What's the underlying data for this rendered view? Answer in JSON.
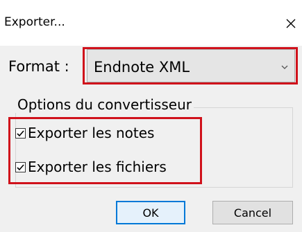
{
  "dialog": {
    "title": "Exporter...",
    "close_icon": "close-icon"
  },
  "format": {
    "label": "Format :",
    "selected": "Endnote XML",
    "chevron_icon": "chevron-down-icon"
  },
  "options": {
    "legend": "Options du convertisseur",
    "items": [
      {
        "label": "Exporter les notes",
        "checked": true
      },
      {
        "label": "Exporter les fichiers",
        "checked": true
      }
    ]
  },
  "buttons": {
    "ok_label": "OK",
    "cancel_label": "Cancel"
  },
  "colors": {
    "highlight": "#d0111b",
    "default_button_border": "#0078d7",
    "panel_background": "#f0f0f0"
  }
}
